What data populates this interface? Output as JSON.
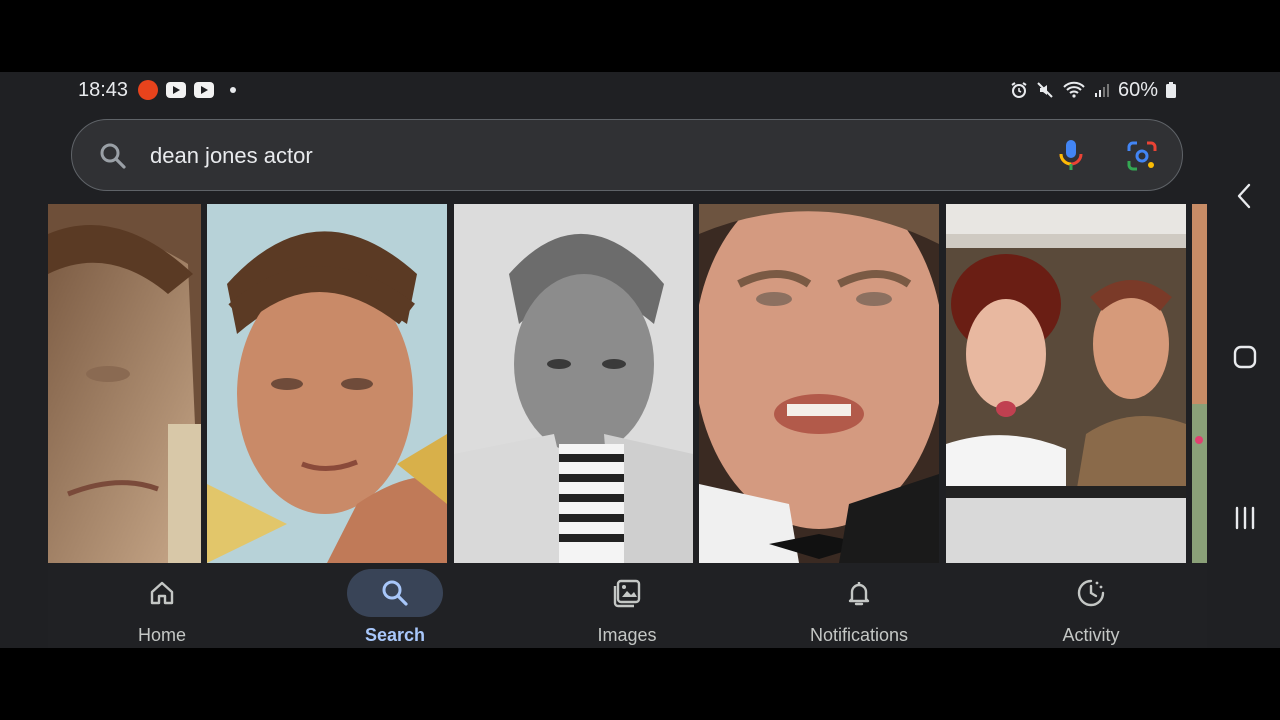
{
  "status_bar": {
    "time": "18:43",
    "battery": "60%"
  },
  "search": {
    "query": "dean jones actor"
  },
  "bottom_nav": [
    {
      "label": "Home",
      "icon": "home-icon",
      "active": false
    },
    {
      "label": "Search",
      "icon": "search-icon",
      "active": true
    },
    {
      "label": "Images",
      "icon": "images-icon",
      "active": false
    },
    {
      "label": "Notifications",
      "icon": "bell-icon",
      "active": false
    },
    {
      "label": "Activity",
      "icon": "activity-icon",
      "active": false
    }
  ],
  "colors": {
    "accent": "#a8c7fa",
    "active_pill": "#394457",
    "background": "#1f2023"
  }
}
